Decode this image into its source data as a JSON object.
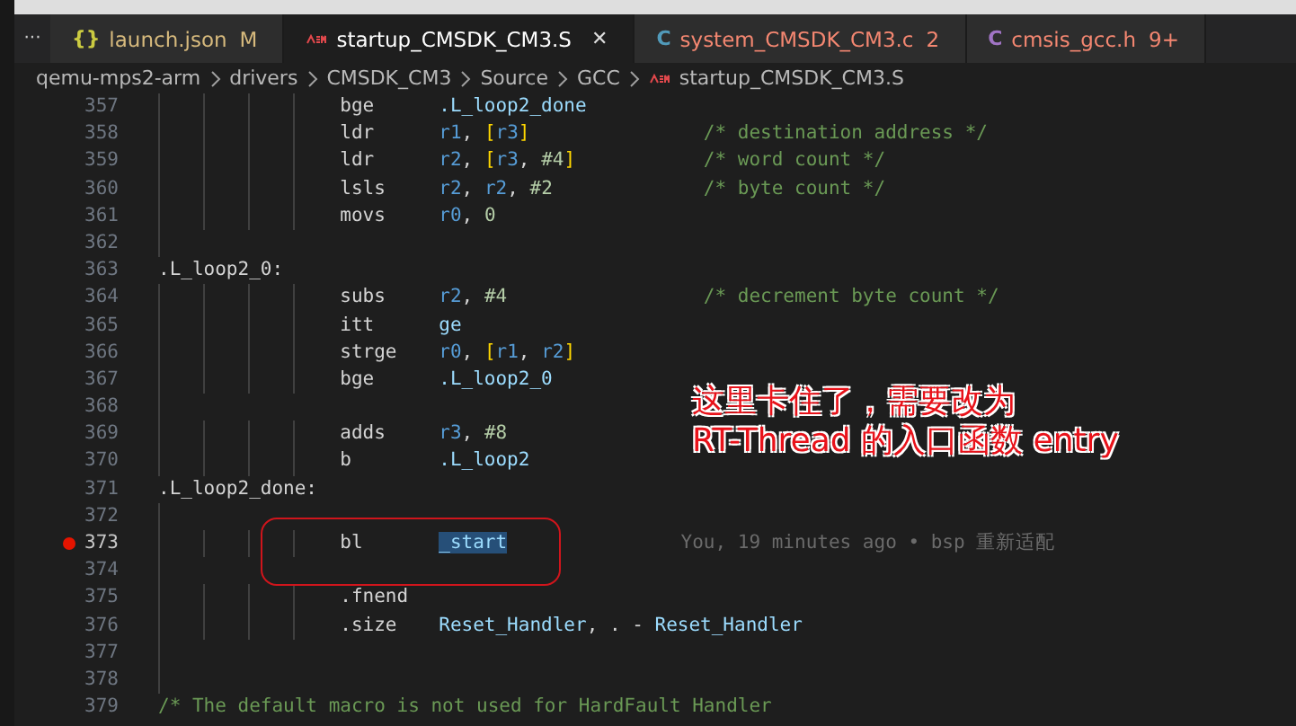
{
  "more_tabs": "···",
  "tabs": [
    {
      "icon": "{}",
      "kind": "json",
      "label": "launch.json",
      "badge": "M",
      "color": "#d7ba7d",
      "selected": false
    },
    {
      "kind": "asm",
      "label": "startup_CMSDK_CM3.S",
      "color": "#ffffff",
      "selected": true,
      "close": "✕"
    },
    {
      "icon": "C",
      "kind": "c",
      "label": "system_CMSDK_CM3.c",
      "badge": "2",
      "color": "#f48771",
      "selected": false
    },
    {
      "icon": "C",
      "kind": "h",
      "label": "cmsis_gcc.h",
      "badge": "9+",
      "color": "#f48771",
      "selected": false
    }
  ],
  "breadcrumbs": [
    {
      "label": "qemu-mps2-arm",
      "kind": "folder"
    },
    {
      "label": "drivers",
      "kind": "folder"
    },
    {
      "label": "CMSDK_CM3",
      "kind": "folder"
    },
    {
      "label": "Source",
      "kind": "folder"
    },
    {
      "label": "GCC",
      "kind": "folder"
    },
    {
      "label": "startup_CMSDK_CM3.S",
      "kind": "asm"
    }
  ],
  "lines": [
    {
      "n": "357",
      "kind": "instr",
      "op": "bge",
      "args": [
        {
          "t": ".L_loop2_done",
          "kind": "sym"
        }
      ]
    },
    {
      "n": "358",
      "kind": "instr",
      "op": "ldr",
      "args": [
        {
          "t": "r1",
          "kind": "reg"
        },
        {
          "t": ", ",
          "kind": "p"
        },
        {
          "t": "[",
          "kind": "br"
        },
        {
          "t": "r3",
          "kind": "reg"
        },
        {
          "t": "]",
          "kind": "br"
        }
      ],
      "comment": "/* destination address */"
    },
    {
      "n": "359",
      "kind": "instr",
      "op": "ldr",
      "args": [
        {
          "t": "r2",
          "kind": "reg"
        },
        {
          "t": ", ",
          "kind": "p"
        },
        {
          "t": "[",
          "kind": "br"
        },
        {
          "t": "r3",
          "kind": "reg"
        },
        {
          "t": ", ",
          "kind": "p"
        },
        {
          "t": "#4",
          "kind": "num"
        },
        {
          "t": "]",
          "kind": "br"
        }
      ],
      "comment": "/* word count */"
    },
    {
      "n": "360",
      "kind": "instr",
      "op": "lsls",
      "args": [
        {
          "t": "r2",
          "kind": "reg"
        },
        {
          "t": ", ",
          "kind": "p"
        },
        {
          "t": "r2",
          "kind": "reg"
        },
        {
          "t": ", ",
          "kind": "p"
        },
        {
          "t": "#2",
          "kind": "num"
        }
      ],
      "comment": "/* byte count */"
    },
    {
      "n": "361",
      "kind": "instr",
      "op": "movs",
      "args": [
        {
          "t": "r0",
          "kind": "reg"
        },
        {
          "t": ", ",
          "kind": "p"
        },
        {
          "t": "0",
          "kind": "num"
        }
      ]
    },
    {
      "n": "362",
      "kind": "blank"
    },
    {
      "n": "363",
      "kind": "label",
      "text": ".L_loop2_0:"
    },
    {
      "n": "364",
      "kind": "instr",
      "op": "subs",
      "args": [
        {
          "t": "r2",
          "kind": "reg"
        },
        {
          "t": ", ",
          "kind": "p"
        },
        {
          "t": "#4",
          "kind": "num"
        }
      ],
      "comment": "/* decrement byte count */"
    },
    {
      "n": "365",
      "kind": "instr",
      "op": "itt",
      "args": [
        {
          "t": "ge",
          "kind": "sym"
        }
      ]
    },
    {
      "n": "366",
      "kind": "instr",
      "op": "strge",
      "args": [
        {
          "t": "r0",
          "kind": "reg"
        },
        {
          "t": ", ",
          "kind": "p"
        },
        {
          "t": "[",
          "kind": "br"
        },
        {
          "t": "r1",
          "kind": "reg"
        },
        {
          "t": ", ",
          "kind": "p"
        },
        {
          "t": "r2",
          "kind": "reg"
        },
        {
          "t": "]",
          "kind": "br"
        }
      ]
    },
    {
      "n": "367",
      "kind": "instr",
      "op": "bge",
      "args": [
        {
          "t": ".L_loop2_0",
          "kind": "sym"
        }
      ]
    },
    {
      "n": "368",
      "kind": "blank"
    },
    {
      "n": "369",
      "kind": "instr",
      "op": "adds",
      "args": [
        {
          "t": "r3",
          "kind": "reg"
        },
        {
          "t": ", ",
          "kind": "p"
        },
        {
          "t": "#8",
          "kind": "num"
        }
      ]
    },
    {
      "n": "370",
      "kind": "instr",
      "op": "b",
      "args": [
        {
          "t": ".L_loop2",
          "kind": "sym"
        }
      ]
    },
    {
      "n": "371",
      "kind": "label",
      "text": ".L_loop2_done:"
    },
    {
      "n": "372",
      "kind": "blank"
    },
    {
      "n": "373",
      "kind": "instr",
      "op": "bl",
      "args": [
        {
          "t": "_start",
          "kind": "sym",
          "selected": true
        }
      ],
      "breakpoint": true,
      "cursor": true,
      "blame": "You, 19 minutes ago • bsp 重新适配"
    },
    {
      "n": "374",
      "kind": "blank"
    },
    {
      "n": "375",
      "kind": "instr",
      "op": ".fnend"
    },
    {
      "n": "376",
      "kind": "instr",
      "op": ".size",
      "args": [
        {
          "t": "Reset_Handler",
          "kind": "sym"
        },
        {
          "t": ", . - ",
          "kind": "p"
        },
        {
          "t": "Reset_Handler",
          "kind": "sym"
        }
      ]
    },
    {
      "n": "377",
      "kind": "blank"
    },
    {
      "n": "378",
      "kind": "blank"
    },
    {
      "n": "379",
      "kind": "comment",
      "text": "/* The default macro is not used for HardFault Handler"
    }
  ],
  "annotation": {
    "lines": [
      "这里卡住了，需要改为",
      "RT-Thread 的入口函数 entry"
    ]
  }
}
